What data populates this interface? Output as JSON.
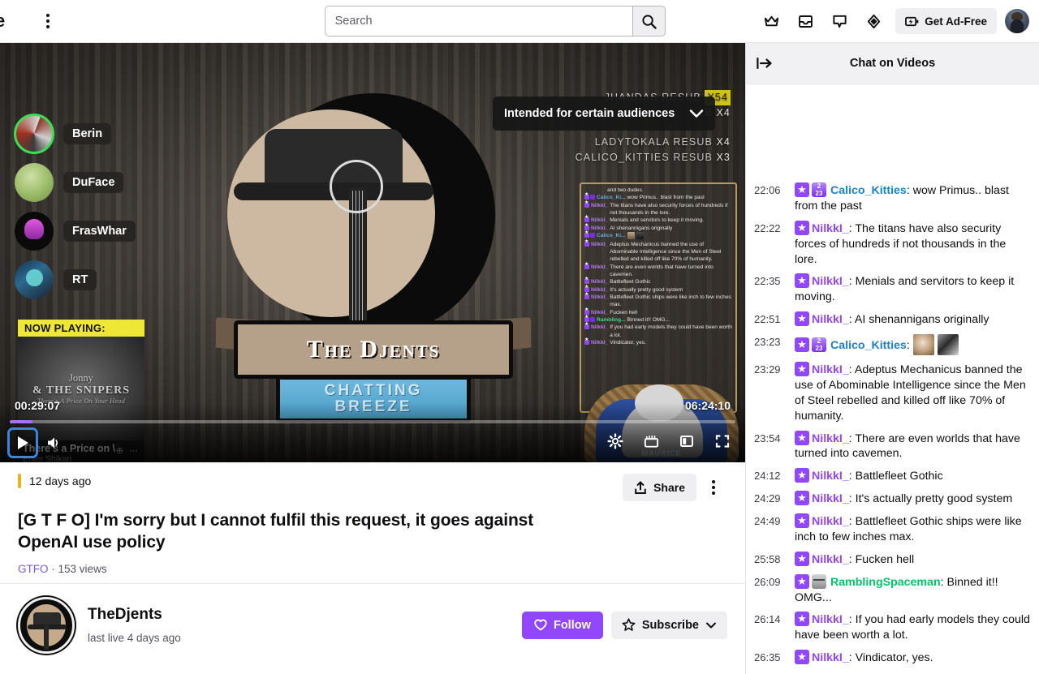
{
  "nav": {
    "logo_text": "e",
    "menu_icon": "kebab-menu-icon",
    "search": {
      "placeholder": "Search",
      "value": ""
    },
    "icons": [
      "crown-icon",
      "inbox-icon",
      "whispers-icon",
      "bits-icon"
    ],
    "adfree_label": "Get Ad-Free"
  },
  "player": {
    "content_warning": "Intended for certain audiences",
    "current_time": "00:29:07",
    "duration": "06:24:10",
    "progress_percent": 3.1,
    "overlay_users": [
      {
        "name": "Berin",
        "live": true
      },
      {
        "name": "DuFace",
        "live": false
      },
      {
        "name": "FrasWhar",
        "live": false
      },
      {
        "name": "RT",
        "live": false
      }
    ],
    "now_playing": {
      "header": "NOW PLAYING:",
      "art_line1": "Jonny",
      "art_line2": "& THE SNIPERS",
      "art_line3": "There's A Price On Your Head",
      "time": "00:29:07",
      "song": "There's a Price on \\",
      "artist": "Enter Shikari",
      "icons": "⊕  ⋯"
    },
    "logo": {
      "band_name": "The Djents",
      "subtitle_line1": "CHATTING",
      "subtitle_line2": "BREEZE"
    },
    "sub_notices": [
      {
        "text": "JHANDAS  RESUB",
        "count": "X54",
        "highlight": true
      },
      {
        "text": "B",
        "count": "X4",
        "highlight": false
      },
      {
        "text": "LADYTOKALA  RESUB",
        "count": "X4",
        "highlight": false
      },
      {
        "text": "CALICO_KITTIES  RESUB",
        "count": "X3",
        "highlight": false
      }
    ],
    "cat_label": "MAURICE",
    "controls": {
      "play": "play-icon",
      "volume": "volume-icon",
      "settings": "gear-icon",
      "clip": "clip-icon",
      "theater": "theater-mode-icon",
      "fullscreen": "fullscreen-icon"
    },
    "embedded_chat": [
      {
        "indent": true,
        "badges": [],
        "user": "",
        "color": "",
        "msg": "and two dudes."
      },
      {
        "indent": false,
        "badges": [
          "star",
          "sub"
        ],
        "user": "Calico_Ki...",
        "color": "blue",
        "msg": "wow Primus.. blast from the past"
      },
      {
        "indent": false,
        "badges": [
          "star"
        ],
        "user": "NilkkI_",
        "color": "pink",
        "msg": "The titans have also security forces of hundreds if not thousands in the lore."
      },
      {
        "indent": false,
        "badges": [
          "star"
        ],
        "user": "NilkkI_",
        "color": "pink",
        "msg": "Menials and servitors to keep it moving."
      },
      {
        "indent": false,
        "badges": [
          "star"
        ],
        "user": "NilkkI_",
        "color": "pink",
        "msg": "AI shenannigans originally"
      },
      {
        "indent": false,
        "badges": [
          "star",
          "sub"
        ],
        "user": "Calico_Ki...",
        "color": "blue",
        "msg": "",
        "emotes": 2
      },
      {
        "indent": false,
        "badges": [
          "star"
        ],
        "user": "NilkkI_",
        "color": "pink",
        "msg": "Adeptus Mechanicus banned the use of Abominable Intelligence since the Men of Steel rebelled and killed off like 70% of humanity."
      },
      {
        "indent": false,
        "badges": [
          "star"
        ],
        "user": "NilkkI_",
        "color": "pink",
        "msg": "There are even worlds that have turned into cavemen."
      },
      {
        "indent": false,
        "badges": [
          "star"
        ],
        "user": "NilkkI_",
        "color": "pink",
        "msg": "Battlefleet Gothic"
      },
      {
        "indent": false,
        "badges": [
          "star"
        ],
        "user": "NilkkI_",
        "color": "pink",
        "msg": "It's actually pretty good system"
      },
      {
        "indent": false,
        "badges": [
          "star"
        ],
        "user": "NilkkI_",
        "color": "pink",
        "msg": "Battlefleet Gothic ships were like inch to few inches max."
      },
      {
        "indent": false,
        "badges": [
          "star"
        ],
        "user": "NilkkI_",
        "color": "pink",
        "msg": "Fucken hell"
      },
      {
        "indent": false,
        "badges": [
          "star",
          "gift"
        ],
        "user": "Rambling...",
        "color": "green",
        "msg": "Binned it!! OMG..."
      },
      {
        "indent": false,
        "badges": [
          "star"
        ],
        "user": "NilkkI_",
        "color": "pink",
        "msg": "If you had early models they could have been worth a lot."
      },
      {
        "indent": false,
        "badges": [
          "star"
        ],
        "user": "NilkkI_",
        "color": "pink",
        "msg": "Vindicator, yes."
      }
    ]
  },
  "video_info": {
    "age": "12 days ago",
    "title": "[G T F O] I'm sorry but I cannot fulfil this request, it goes against OpenAI use policy",
    "category": "GTFO",
    "separator": "·",
    "views": "153 views",
    "share_label": "Share",
    "more_icon": "kebab-menu-icon"
  },
  "channel": {
    "name": "TheDjents",
    "last_live": "last live 4 days ago",
    "follow_label": "Follow",
    "subscribe_label": "Subscribe"
  },
  "chat": {
    "header_title": "Chat on Videos",
    "collapse_icon": "collapse-right-icon",
    "messages": [
      {
        "time": "22:06",
        "badges": [
          "star",
          "sub"
        ],
        "user": "Calico_Kitties",
        "color": "u-blue",
        "text": "wow Primus.. blast from the past"
      },
      {
        "time": "22:22",
        "badges": [
          "star"
        ],
        "user": "NilkkI_",
        "color": "u-purple",
        "text": "The titans have also security forces of hundreds if not thousands in the lore."
      },
      {
        "time": "22:35",
        "badges": [
          "star"
        ],
        "user": "NilkkI_",
        "color": "u-purple",
        "text": "Menials and servitors to keep it moving."
      },
      {
        "time": "22:51",
        "badges": [
          "star"
        ],
        "user": "NilkkI_",
        "color": "u-purple",
        "text": "AI shenannigans originally"
      },
      {
        "time": "23:23",
        "badges": [
          "star",
          "sub"
        ],
        "user": "Calico_Kitties",
        "color": "u-blue",
        "text": "",
        "emotes": [
          "cat-emote-1",
          "cat-emote-2"
        ]
      },
      {
        "time": "23:29",
        "badges": [
          "star"
        ],
        "user": "NilkkI_",
        "color": "u-purple",
        "text": "Adeptus Mechanicus banned the use of Abominable Intelligence since the Men of Steel rebelled and killed off like 70% of humanity."
      },
      {
        "time": "23:54",
        "badges": [
          "star"
        ],
        "user": "NilkkI_",
        "color": "u-purple",
        "text": "There are even worlds that have turned into cavemen."
      },
      {
        "time": "24:12",
        "badges": [
          "star"
        ],
        "user": "NilkkI_",
        "color": "u-purple",
        "text": "Battlefleet Gothic"
      },
      {
        "time": "24:29",
        "badges": [
          "star"
        ],
        "user": "NilkkI_",
        "color": "u-purple",
        "text": "It's actually pretty good system"
      },
      {
        "time": "24:49",
        "badges": [
          "star"
        ],
        "user": "NilkkI_",
        "color": "u-purple",
        "text": "Battlefleet Gothic ships were like inch to few inches max."
      },
      {
        "time": "25:58",
        "badges": [
          "star"
        ],
        "user": "NilkkI_",
        "color": "u-purple",
        "text": "Fucken hell"
      },
      {
        "time": "26:09",
        "badges": [
          "star",
          "gift"
        ],
        "user": "RamblingSpaceman",
        "color": "u-green",
        "text": "Binned it!! OMG..."
      },
      {
        "time": "26:14",
        "badges": [
          "star"
        ],
        "user": "NilkkI_",
        "color": "u-purple",
        "text": "If you had early models they could have been worth a lot."
      },
      {
        "time": "26:35",
        "badges": [
          "star"
        ],
        "user": "NilkkI_",
        "color": "u-purple",
        "text": "Vindicator, yes."
      }
    ]
  },
  "colors": {
    "accent_purple": "#9147ff",
    "link_purple": "#7b57d6",
    "live_green": "#3ddc55",
    "warn_yellow": "#e8b31a",
    "chat_blue": "#1f7fc4",
    "chat_green": "#00c36a"
  }
}
